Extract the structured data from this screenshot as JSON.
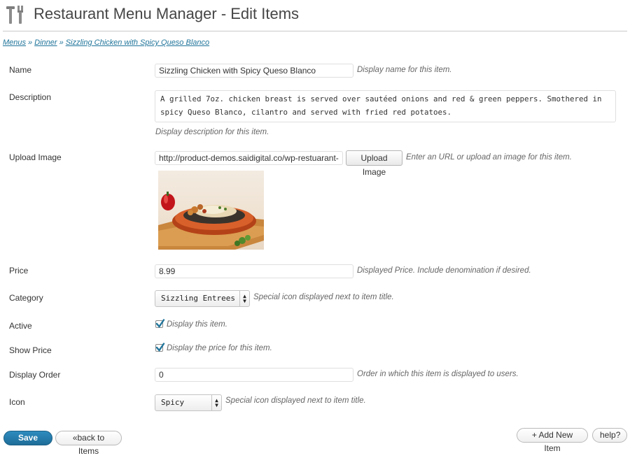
{
  "header": {
    "title": "Restaurant Menu Manager - Edit Items",
    "icon": "tools-icon"
  },
  "breadcrumb": {
    "items": [
      "Menus",
      "Dinner",
      "Sizzling Chicken with Spicy Queso Blanco"
    ],
    "separator": "»"
  },
  "form": {
    "name": {
      "label": "Name",
      "value": "Sizzling Chicken with Spicy Queso Blanco",
      "hint": "Display name for this item."
    },
    "description": {
      "label": "Description",
      "value": "A grilled 7oz. chicken breast is served over sautéed onions and red & green peppers. Smothered in spicy Queso Blanco, cilantro and served with fried red potatoes.",
      "hint": "Display description for this item."
    },
    "upload_image": {
      "label": "Upload Image",
      "value": "http://product-demos.saidigital.co/wp-restuarant-me",
      "button": "Upload Image",
      "hint": "Enter an URL or upload an image for this item."
    },
    "price": {
      "label": "Price",
      "value": "8.99",
      "hint": "Displayed Price. Include denomination if desired."
    },
    "category": {
      "label": "Category",
      "selected": "Sizzling Entrees",
      "hint": "Special icon displayed next to item title."
    },
    "active": {
      "label": "Active",
      "checked": true,
      "hint": "Display this item."
    },
    "show_price": {
      "label": "Show Price",
      "checked": true,
      "hint": "Display the price for this item."
    },
    "display_order": {
      "label": "Display Order",
      "value": "0",
      "hint": "Order in which this item is displayed to users."
    },
    "icon": {
      "label": "Icon",
      "selected": "Spicy",
      "hint": "Special icon displayed next to item title."
    }
  },
  "buttons": {
    "save": "Save Item",
    "back": "«back to Items",
    "add_new": "+ Add New Item",
    "help": "help?"
  },
  "colors": {
    "link": "#21759b",
    "primary_button": "#21759b",
    "checkbox_check": "#21759b"
  }
}
